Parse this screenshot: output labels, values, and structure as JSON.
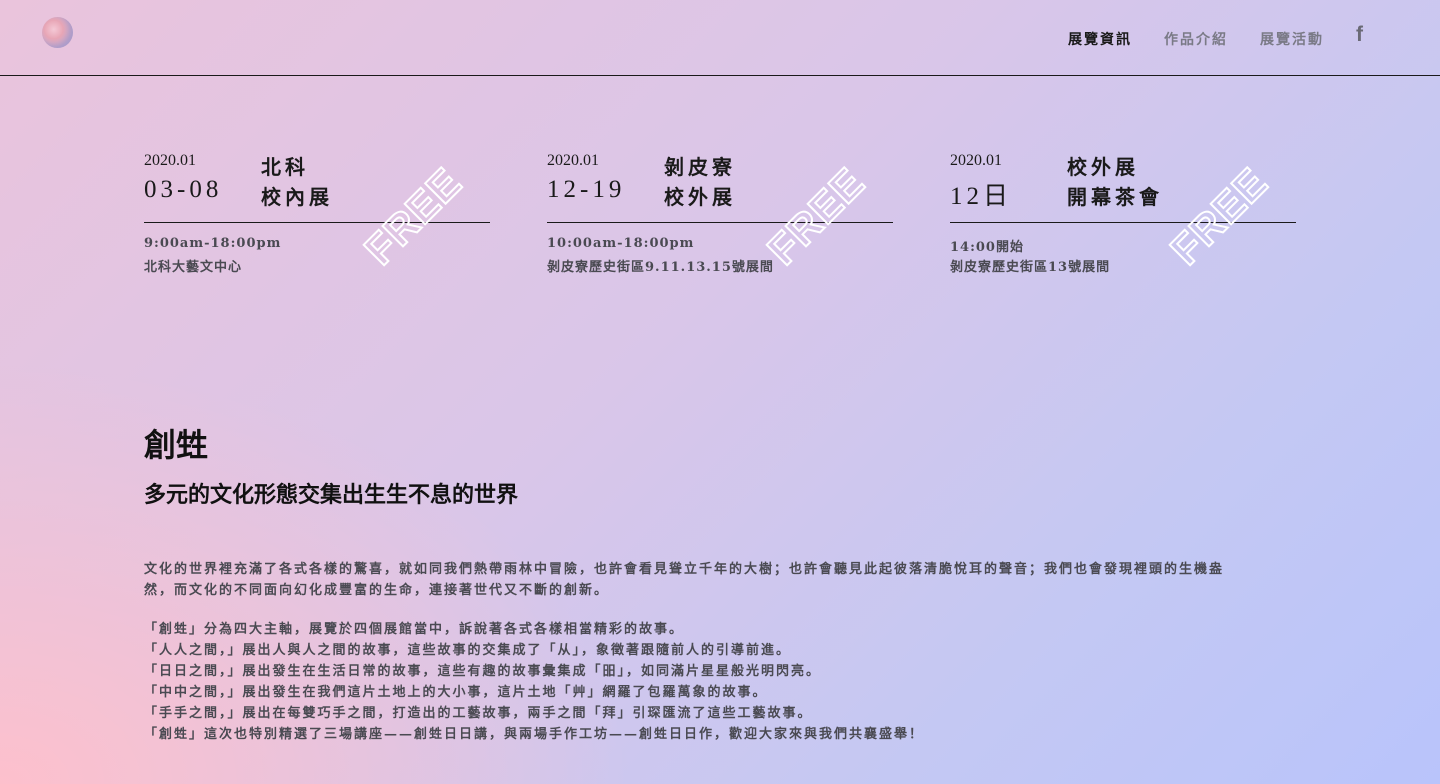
{
  "header": {
    "nav": [
      {
        "label": "展覽資訊",
        "active": true
      },
      {
        "label": "作品介紹",
        "active": false
      },
      {
        "label": "展覽活動",
        "active": false
      }
    ],
    "facebook_icon": "facebook-icon",
    "facebook_glyph": "f"
  },
  "events": [
    {
      "year": "2020.01",
      "day": "03-08",
      "title1": "北科",
      "title2": "校內展",
      "time": "9:00am-18:00pm",
      "place": "北科大藝文中心",
      "stamp": "FREE"
    },
    {
      "year": "2020.01",
      "day": "12-19",
      "title1": "剝皮寮",
      "title2": "校外展",
      "time": "10:00am-18:00pm",
      "place": "剝皮寮歷史街區9.11.13.15號展間",
      "stamp": "FREE"
    },
    {
      "year": "2020.01",
      "day": "12日",
      "title1": "校外展",
      "title2": "開幕茶會",
      "time": "14:00開始",
      "place": "剝皮寮歷史街區13號展間",
      "stamp": "FREE"
    }
  ],
  "intro": {
    "title": "創甡",
    "subtitle": "多元的文化形態交集出生生不息的世界",
    "paragraph1": [
      "文化的世界裡充滿了各式各樣的驚喜，就如同我們熱帶雨林中冒險，也許會看見聳立千年的大樹；也許會聽見此起彼落清脆悅耳的聲音；我們也會發現裡頭的生機盎",
      "然，而文化的不同面向幻化成豐富的生命，連接著世代又不斷的創新。"
    ],
    "paragraph2": [
      "「創甡」分為四大主軸，展覽於四個展館當中，訴說著各式各樣相當精彩的故事。",
      "「人人之間，」展出人與人之間的故事，這些故事的交集成了「从」，象徵著跟隨前人的引導前進。",
      "「日日之間，」展出發生在生活日常的故事，這些有趣的故事彙集成「昍」，如同滿片星星般光明閃亮。",
      "「中中之間，」展出發生在我們這片土地上的大小事，這片土地「艸」網羅了包羅萬象的故事。",
      "「手手之間，」展出在每雙巧手之間，打造出的工藝故事，兩手之間「拜」引琛匯流了這些工藝故事。",
      "「創甡」這次也特別精選了三場講座——創甡日日講，與兩場手作工坊——創甡日日作，歡迎大家來與我們共襄盛舉！"
    ]
  }
}
